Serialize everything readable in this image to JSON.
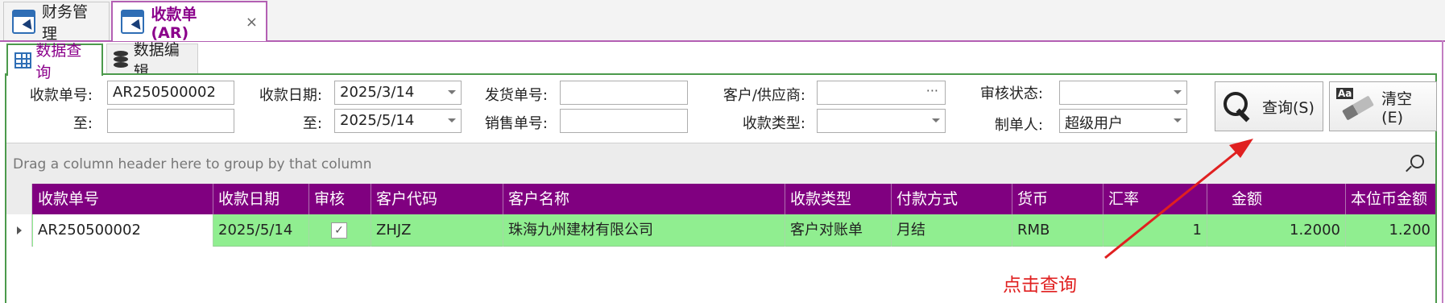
{
  "doc_tabs": [
    {
      "label": "财务管理",
      "icon": "window-icon"
    },
    {
      "label": "收款单(AR)",
      "icon": "window-icon",
      "close": "×"
    }
  ],
  "sub_tabs": [
    {
      "label": "数据查询",
      "icon": "grid-icon"
    },
    {
      "label": "数据编辑",
      "icon": "database-icon"
    }
  ],
  "filters": {
    "receipt_no": {
      "label": "收款单号:",
      "value": "AR250500002"
    },
    "receipt_no_to": {
      "label": "至:",
      "value": ""
    },
    "receipt_date": {
      "label": "收款日期:",
      "value": "2025/3/14"
    },
    "receipt_date_to": {
      "label": "至:",
      "value": "2025/5/14"
    },
    "ship_no": {
      "label": "发货单号:",
      "value": ""
    },
    "sales_no": {
      "label": "销售单号:",
      "value": ""
    },
    "customer": {
      "label": "客户/供应商:",
      "value": "",
      "ellipsis": "···"
    },
    "receipt_type": {
      "label": "收款类型:",
      "value": ""
    },
    "audit_status": {
      "label": "审核状态:",
      "value": ""
    },
    "creator": {
      "label": "制单人:",
      "value": "超级用户"
    }
  },
  "buttons": {
    "query": "查询(S)",
    "clear": "清空(E)",
    "clear_icon_text": "Aa"
  },
  "group_panel": {
    "text": "Drag a column header here to group by that column"
  },
  "grid": {
    "headers": [
      "收款单号",
      "收款日期",
      "审核",
      "客户代码",
      "客户名称",
      "收款类型",
      "付款方式",
      "货币",
      "汇率",
      "金额",
      "本位币金额"
    ],
    "rows": [
      [
        "AR250500002",
        "2025/5/14",
        "✓",
        "ZHJZ",
        "珠海九州建材有限公司",
        "客户对账单",
        "月结",
        "RMB",
        "1",
        "1.2000",
        "1.200"
      ]
    ]
  },
  "annotation": {
    "text": "点击查询",
    "color": "#e02020"
  },
  "colors": {
    "accent": "#800080",
    "row_highlight": "#90ee90",
    "panel_border": "#4c9a4c"
  }
}
